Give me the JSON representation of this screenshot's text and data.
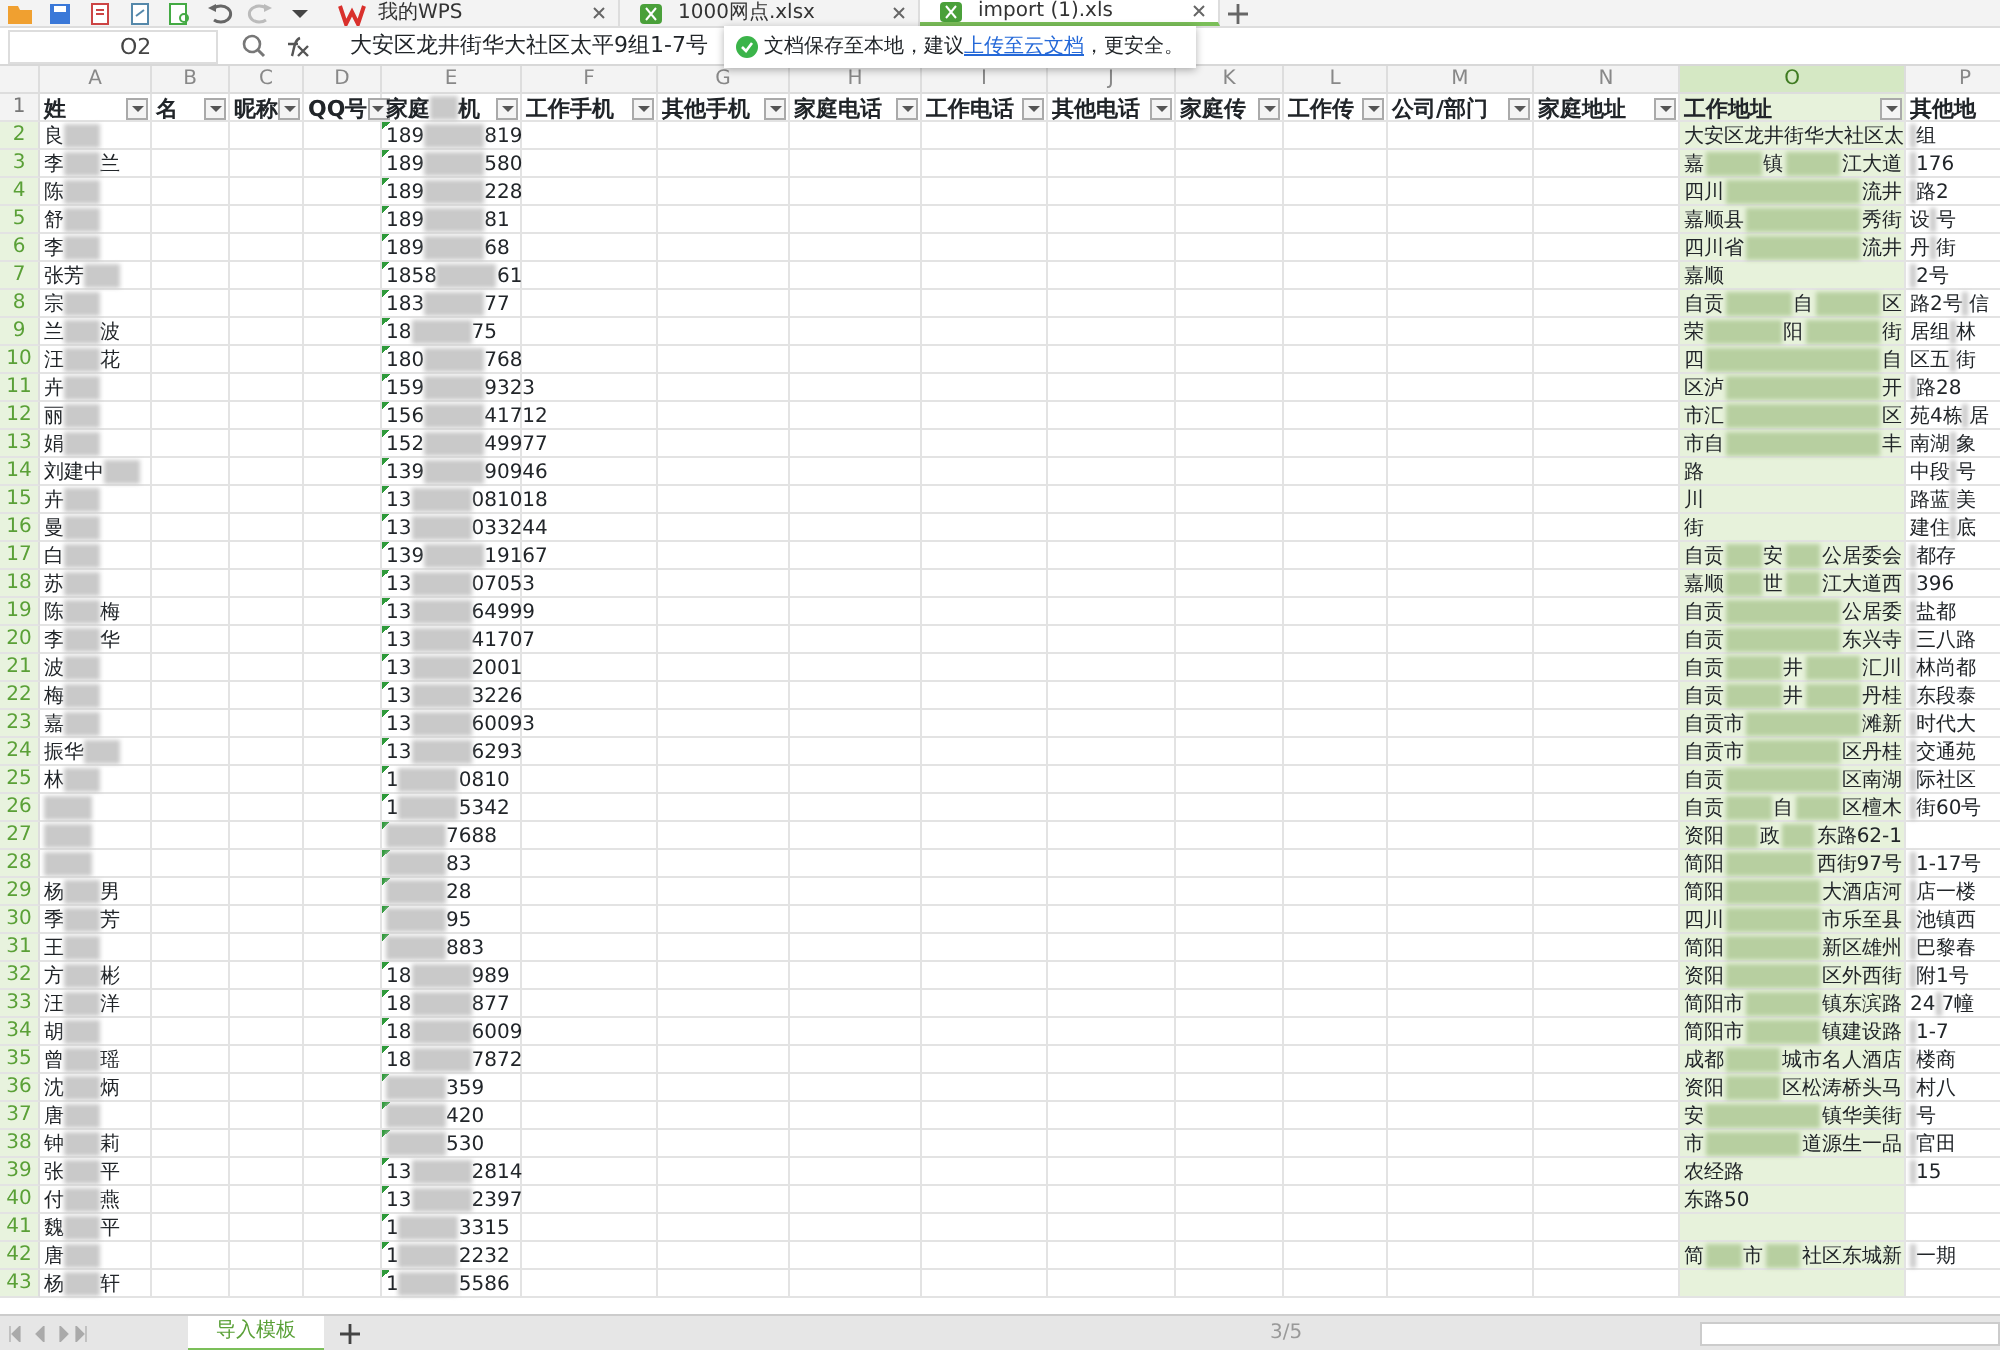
{
  "tabs": [
    {
      "label": "我的WPS",
      "kind": "wps",
      "selected": false
    },
    {
      "label": "1000网点.xlsx",
      "kind": "sheet",
      "selected": false
    },
    {
      "label": "import (1).xls",
      "kind": "sheet",
      "selected": true
    }
  ],
  "formula_bar": {
    "cell": "O2",
    "formula": "大安区龙井街华大社区太平9组1-7号"
  },
  "notice": {
    "text_before": "文档保存至本地，建议",
    "link": "上传至云文档",
    "text_after": "，更安全。"
  },
  "header_row_number": "1",
  "columns": [
    {
      "letter": "A",
      "header": [
        "姓"
      ],
      "filter": true,
      "selected": false
    },
    {
      "letter": "B",
      "header": [
        "名"
      ],
      "filter": true,
      "selected": false
    },
    {
      "letter": "C",
      "header": [
        "昵称"
      ],
      "filter": true,
      "selected": false
    },
    {
      "letter": "D",
      "header": [
        "QQ号"
      ],
      "filter": true,
      "selected": false
    },
    {
      "letter": "E",
      "header": [
        "家庭",
        "机"
      ],
      "filter": true,
      "selected": false
    },
    {
      "letter": "F",
      "header": [
        "工作手机"
      ],
      "filter": true,
      "selected": false
    },
    {
      "letter": "G",
      "header": [
        "其他手机"
      ],
      "filter": true,
      "selected": false
    },
    {
      "letter": "H",
      "header": [
        "家庭电话"
      ],
      "filter": true,
      "selected": false
    },
    {
      "letter": "I",
      "header": [
        "工作电话"
      ],
      "filter": true,
      "selected": false
    },
    {
      "letter": "J",
      "header": [
        "其他电话"
      ],
      "filter": true,
      "selected": false
    },
    {
      "letter": "K",
      "header": [
        "家庭传"
      ],
      "filter": true,
      "selected": false
    },
    {
      "letter": "L",
      "header": [
        "工作传"
      ],
      "filter": true,
      "selected": false
    },
    {
      "letter": "M",
      "header": [
        "公司/部门"
      ],
      "filter": true,
      "selected": false
    },
    {
      "letter": "N",
      "header": [
        "家庭地址"
      ],
      "filter": true,
      "selected": false
    },
    {
      "letter": "O",
      "header": [
        "工作地址"
      ],
      "filter": true,
      "selected": true
    },
    {
      "letter": "P",
      "header": [
        "其他地"
      ],
      "filter": false,
      "selected": false
    }
  ],
  "rows": [
    {
      "number": "2",
      "name": [
        "良"
      ],
      "phone": [
        "189",
        "819"
      ],
      "work_address": [
        "大安区龙井街华大社区太"
      ],
      "other_address": [
        "组"
      ]
    },
    {
      "number": "3",
      "name": [
        "李",
        "兰"
      ],
      "phone": [
        "189",
        "580"
      ],
      "work_address": [
        "嘉",
        "镇",
        "江大道"
      ],
      "other_address": [
        "176"
      ]
    },
    {
      "number": "4",
      "name": [
        "陈"
      ],
      "phone": [
        "189",
        "228"
      ],
      "work_address": [
        "四川",
        "流井"
      ],
      "other_address": [
        "路2"
      ]
    },
    {
      "number": "5",
      "name": [
        "舒"
      ],
      "phone": [
        "189",
        "81"
      ],
      "work_address": [
        "嘉顺县",
        "秀街"
      ],
      "other_address": [
        "设",
        "号"
      ]
    },
    {
      "number": "6",
      "name": [
        "李"
      ],
      "phone": [
        "189",
        "68"
      ],
      "work_address": [
        "四川省",
        "流井"
      ],
      "other_address": [
        "丹",
        "街"
      ]
    },
    {
      "number": "7",
      "name": [
        "张芳"
      ],
      "phone": [
        "1858",
        "61"
      ],
      "work_address": [
        "嘉顺"
      ],
      "other_address": [
        "2号"
      ]
    },
    {
      "number": "8",
      "name": [
        "宗"
      ],
      "phone": [
        "183",
        "77"
      ],
      "work_address": [
        "自贡",
        "自",
        "区"
      ],
      "other_address": [
        "路2号",
        "信"
      ]
    },
    {
      "number": "9",
      "name": [
        "兰",
        "波"
      ],
      "phone": [
        "18",
        "75"
      ],
      "work_address": [
        "荣",
        "阳",
        "街"
      ],
      "other_address": [
        "居组",
        "林"
      ]
    },
    {
      "number": "10",
      "name": [
        "汪",
        "花"
      ],
      "phone": [
        "180",
        "768"
      ],
      "work_address": [
        "四",
        "自"
      ],
      "other_address": [
        "区五",
        "街"
      ]
    },
    {
      "number": "11",
      "name": [
        "卉"
      ],
      "phone": [
        "159",
        "9323"
      ],
      "work_address": [
        "区泸",
        "开"
      ],
      "other_address": [
        "路28"
      ]
    },
    {
      "number": "12",
      "name": [
        "丽"
      ],
      "phone": [
        "156",
        "41712"
      ],
      "work_address": [
        "市汇",
        "区"
      ],
      "other_address": [
        "苑4栋",
        "居"
      ]
    },
    {
      "number": "13",
      "name": [
        "娟"
      ],
      "phone": [
        "152",
        "49977"
      ],
      "work_address": [
        "市自",
        "丰"
      ],
      "other_address": [
        "南湖",
        "象"
      ]
    },
    {
      "number": "14",
      "name": [
        "刘建中"
      ],
      "phone": [
        "139",
        "90946"
      ],
      "work_address": [
        "路"
      ],
      "other_address": [
        "中段",
        "号"
      ]
    },
    {
      "number": "15",
      "name": [
        "卉"
      ],
      "phone": [
        "13",
        "081018"
      ],
      "work_address": [
        "川"
      ],
      "other_address": [
        "路蓝",
        "美"
      ]
    },
    {
      "number": "16",
      "name": [
        "曼"
      ],
      "phone": [
        "13",
        "033244"
      ],
      "work_address": [
        "街"
      ],
      "other_address": [
        "建住",
        "底"
      ]
    },
    {
      "number": "17",
      "name": [
        "白"
      ],
      "phone": [
        "139",
        "19167"
      ],
      "work_address": [
        "自贡",
        "安",
        "公居委会"
      ],
      "other_address": [
        "都存"
      ]
    },
    {
      "number": "18",
      "name": [
        "苏"
      ],
      "phone": [
        "13",
        "07053"
      ],
      "work_address": [
        "嘉顺",
        "世",
        "江大道西"
      ],
      "other_address": [
        "396"
      ]
    },
    {
      "number": "19",
      "name": [
        "陈",
        "梅"
      ],
      "phone": [
        "13",
        "64999"
      ],
      "work_address": [
        "自贡",
        "公居委"
      ],
      "other_address": [
        "盐都"
      ]
    },
    {
      "number": "20",
      "name": [
        "李",
        "华"
      ],
      "phone": [
        "13",
        "41707"
      ],
      "work_address": [
        "自贡",
        "东兴寺"
      ],
      "other_address": [
        "三八路"
      ]
    },
    {
      "number": "21",
      "name": [
        "波"
      ],
      "phone": [
        "13",
        "2001"
      ],
      "work_address": [
        "自贡",
        "井",
        "汇川"
      ],
      "other_address": [
        "林尚都"
      ]
    },
    {
      "number": "22",
      "name": [
        "梅"
      ],
      "phone": [
        "13",
        "3226"
      ],
      "work_address": [
        "自贡",
        "井",
        "丹桂"
      ],
      "other_address": [
        "东段泰"
      ]
    },
    {
      "number": "23",
      "name": [
        "嘉"
      ],
      "phone": [
        "13",
        "60093"
      ],
      "work_address": [
        "自贡市",
        "滩新"
      ],
      "other_address": [
        "时代大"
      ]
    },
    {
      "number": "24",
      "name": [
        "振华"
      ],
      "phone": [
        "13",
        "6293"
      ],
      "work_address": [
        "自贡市",
        "区丹桂"
      ],
      "other_address": [
        "交通苑"
      ]
    },
    {
      "number": "25",
      "name": [
        "林"
      ],
      "phone": [
        "1",
        "0810"
      ],
      "work_address": [
        "自贡",
        "区南湖"
      ],
      "other_address": [
        "际社区"
      ]
    },
    {
      "number": "26",
      "phone": [
        "1",
        "5342"
      ],
      "work_address": [
        "自贡",
        "自",
        "区檀木"
      ],
      "other_address": [
        "街60号"
      ]
    },
    {
      "number": "27",
      "phone": [
        "7688"
      ],
      "work_address": [
        "资阳",
        "政",
        "东路62-1"
      ]
    },
    {
      "number": "28",
      "phone": [
        "83"
      ],
      "work_address": [
        "简阳",
        "西街97号"
      ],
      "other_address": [
        "1-17号"
      ]
    },
    {
      "number": "29",
      "name": [
        "杨",
        "男"
      ],
      "phone": [
        "28"
      ],
      "work_address": [
        "简阳",
        "大酒店河"
      ],
      "other_address": [
        "店一楼"
      ]
    },
    {
      "number": "30",
      "name": [
        "季",
        "芳"
      ],
      "phone": [
        "95"
      ],
      "work_address": [
        "四川",
        "市乐至县"
      ],
      "other_address": [
        "池镇西"
      ]
    },
    {
      "number": "31",
      "name": [
        "王"
      ],
      "phone": [
        "883"
      ],
      "work_address": [
        "简阳",
        "新区雄州"
      ],
      "other_address": [
        "巴黎春"
      ]
    },
    {
      "number": "32",
      "name": [
        "方",
        "彬"
      ],
      "phone": [
        "18",
        "989"
      ],
      "work_address": [
        "资阳",
        "区外西街"
      ],
      "other_address": [
        "附1号"
      ]
    },
    {
      "number": "33",
      "name": [
        "汪",
        "洋"
      ],
      "phone": [
        "18",
        "877"
      ],
      "work_address": [
        "简阳市",
        "镇东滨路"
      ],
      "other_address": [
        "24",
        "7幢"
      ]
    },
    {
      "number": "34",
      "name": [
        "胡"
      ],
      "phone": [
        "18",
        "6009"
      ],
      "work_address": [
        "简阳市",
        "镇建设路"
      ],
      "other_address": [
        "1-7"
      ]
    },
    {
      "number": "35",
      "name": [
        "曾",
        "瑶"
      ],
      "phone": [
        "18",
        "7872"
      ],
      "work_address": [
        "成都",
        "城市名人酒店"
      ],
      "other_address": [
        "楼商"
      ]
    },
    {
      "number": "36",
      "name": [
        "沈",
        "炳"
      ],
      "phone": [
        "359"
      ],
      "work_address": [
        "资阳",
        "区松涛桥头马"
      ],
      "other_address": [
        "村八"
      ]
    },
    {
      "number": "37",
      "name": [
        "唐"
      ],
      "phone": [
        "420"
      ],
      "work_address": [
        "安",
        "镇华美街"
      ],
      "other_address": [
        "号"
      ]
    },
    {
      "number": "38",
      "name": [
        "钟",
        "莉"
      ],
      "phone": [
        "530"
      ],
      "work_address": [
        "市",
        "道源生一品"
      ],
      "other_address": [
        "官田"
      ]
    },
    {
      "number": "39",
      "name": [
        "张",
        "平"
      ],
      "phone": [
        "13",
        "2814"
      ],
      "work_address": [
        "农经路"
      ],
      "other_address": [
        "15"
      ]
    },
    {
      "number": "40",
      "name": [
        "付",
        "燕"
      ],
      "phone": [
        "13",
        "2397"
      ],
      "work_address": [
        "东路50"
      ]
    },
    {
      "number": "41",
      "name": [
        "魏",
        "平"
      ],
      "phone": [
        "1",
        "3315"
      ]
    },
    {
      "number": "42",
      "name": [
        "唐"
      ],
      "phone": [
        "1",
        "2232"
      ],
      "work_address": [
        "简",
        "市",
        "社区东城新"
      ],
      "other_address": [
        "一期"
      ]
    },
    {
      "number": "43",
      "name": [
        "杨",
        "轩"
      ],
      "phone": [
        "1",
        "5586"
      ]
    }
  ],
  "sheet_tabs": [
    {
      "label": "导入模板",
      "selected": true
    }
  ],
  "page_indicator": "3/5"
}
